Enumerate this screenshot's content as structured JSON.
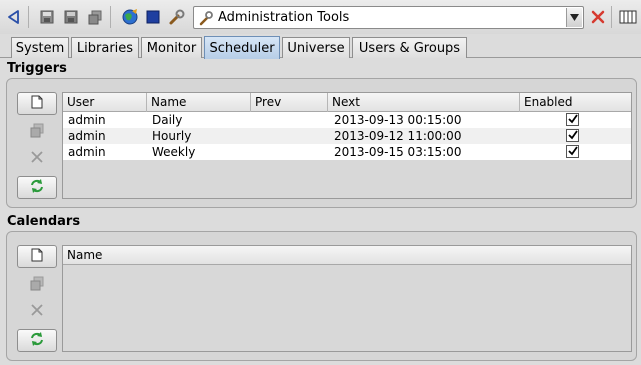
{
  "toolbar": {
    "combo_value": "Administration Tools",
    "icons": [
      "back-arrow-icon",
      "save-icon",
      "save-all-icon",
      "properties-icon",
      "globe-icon",
      "stop-icon",
      "wrench-icon",
      "close-icon",
      "columns-icon"
    ]
  },
  "tabs": [
    {
      "label": "System",
      "active": false
    },
    {
      "label": "Libraries",
      "active": false
    },
    {
      "label": "Monitor",
      "active": false
    },
    {
      "label": "Scheduler",
      "active": true
    },
    {
      "label": "Universe",
      "active": false
    },
    {
      "label": "Users & Groups",
      "active": false
    }
  ],
  "triggers": {
    "title": "Triggers",
    "columns": [
      "User",
      "Name",
      "Prev",
      "Next",
      "Enabled"
    ],
    "rows": [
      {
        "user": "admin",
        "name": "Daily",
        "prev": "",
        "next": "2013-09-13 00:15:00",
        "enabled": true
      },
      {
        "user": "admin",
        "name": "Hourly",
        "prev": "",
        "next": "2013-09-12 11:00:00",
        "enabled": true
      },
      {
        "user": "admin",
        "name": "Weekly",
        "prev": "",
        "next": "2013-09-15 03:15:00",
        "enabled": true
      }
    ]
  },
  "calendars": {
    "title": "Calendars",
    "columns": [
      "Name"
    ]
  },
  "colors": {
    "active_tab": "#b6cde7",
    "close_red": "#d63a2f",
    "stop_blue": "#1f3fa0"
  }
}
